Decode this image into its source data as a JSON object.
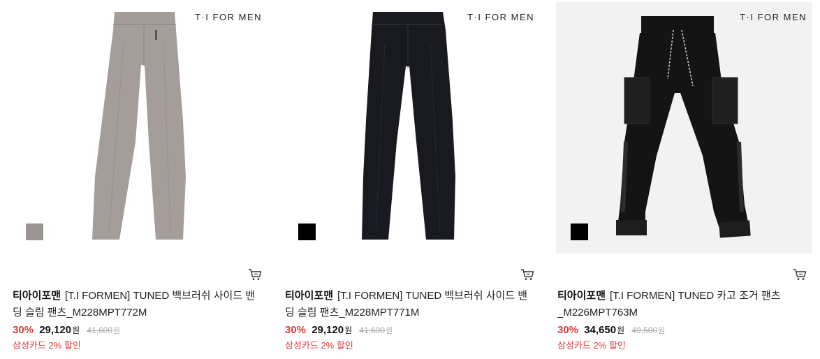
{
  "products": [
    {
      "brand_mark": "T·I FOR MEN",
      "swatch_color": "#9a9593",
      "pants_color": "#a49d9a",
      "brand": "티아이포맨",
      "name": "[T.I FORMEN] TUNED 백브러쉬 사이드 밴딩 슬림 팬츠_M228MPT772M",
      "discount_rate": "30%",
      "sale_price": "29,120",
      "sale_currency": "원",
      "original_price": "41,600",
      "original_currency": "원",
      "promo": "삼성카드 2% 할인",
      "cart_icon": "cart-icon"
    },
    {
      "brand_mark": "T·I FOR MEN",
      "swatch_color": "#000000",
      "pants_color": "#191a20",
      "brand": "티아이포맨",
      "name": "[T.I FORMEN] TUNED 백브러쉬 사이드 밴딩 슬림 팬츠_M228MPT771M",
      "discount_rate": "30%",
      "sale_price": "29,120",
      "sale_currency": "원",
      "original_price": "41,600",
      "original_currency": "원",
      "promo": "삼성카드 2% 할인",
      "cart_icon": "cart-icon"
    },
    {
      "brand_mark": "T·I FOR MEN",
      "swatch_color": "#000000",
      "pants_color": "#141414",
      "brand": "티아이포맨",
      "name": "[T.I FORMEN] TUNED 카고 조거 팬츠_M226MPT763M",
      "discount_rate": "30%",
      "sale_price": "34,650",
      "sale_currency": "원",
      "original_price": "49,500",
      "original_currency": "원",
      "promo": "삼성카드 2% 할인",
      "cart_icon": "cart-icon"
    }
  ]
}
